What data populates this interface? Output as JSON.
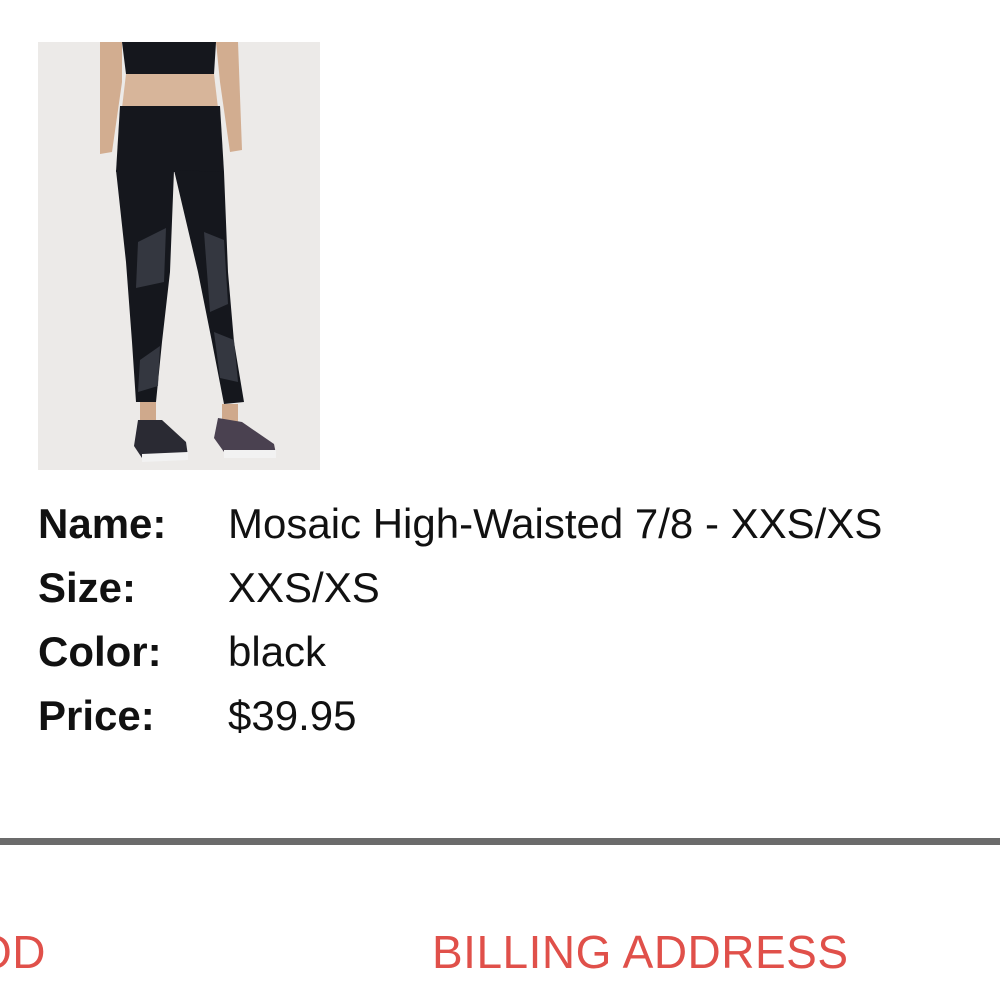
{
  "product": {
    "image_alt": "Mosaic High-Waisted 7/8 leggings",
    "details": [
      {
        "label": "Name:",
        "value": "Mosaic High-Waisted 7/8 - XXS/XS"
      },
      {
        "label": "Size:",
        "value": "XXS/XS"
      },
      {
        "label": "Color:",
        "value": "black"
      },
      {
        "label": "Price:",
        "value": "$39.95"
      }
    ]
  },
  "checkout_steps": {
    "previous_partial": "OD",
    "current": "BILLING ADDRESS"
  },
  "colors": {
    "accent": "#e0504a",
    "divider": "#6b6b6b",
    "image_background": "#eceae8",
    "garment": "#14161c"
  }
}
